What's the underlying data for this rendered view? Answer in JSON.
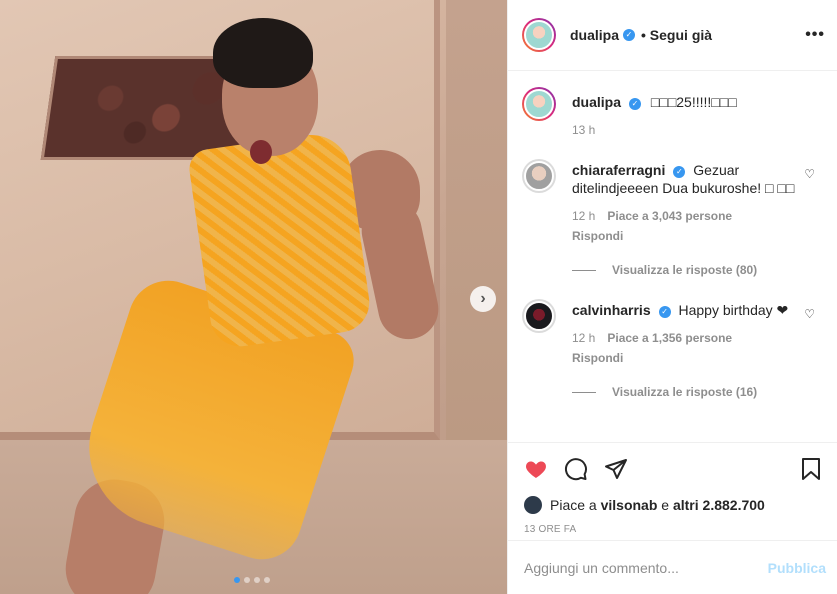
{
  "post": {
    "photo_alt": "",
    "carousel": {
      "total": 4,
      "active_index": 0
    }
  },
  "header": {
    "username": "dualipa",
    "follow_status": "• Segui già",
    "more": "•••"
  },
  "caption": {
    "username": "dualipa",
    "text": "□□□25!!!!!□□□",
    "time": "13 h"
  },
  "comments": [
    {
      "username": "chiaraferragni",
      "text": "Gezuar ditelindjeeeen Dua bukuroshe! □ □□",
      "time": "12 h",
      "likes": "Piace a 3,043 persone",
      "reply": "Rispondi",
      "view_replies": "Visualizza le risposte (80)"
    },
    {
      "username": "calvinharris",
      "text": "Happy birthday ❤",
      "time": "12 h",
      "likes": "Piace a 1,356 persone",
      "reply": "Rispondi",
      "view_replies": "Visualizza le risposte (16)"
    }
  ],
  "likes_line": {
    "prefix": "Piace a",
    "user": "vilsonab",
    "middle": "e",
    "rest": "altri 2.882.700"
  },
  "timestamp": "13 ORE FA",
  "composer": {
    "placeholder": "Aggiungi un commento...",
    "post_label": "Pubblica"
  },
  "colors": {
    "accent": "#3897f0",
    "like": "#ed4956",
    "post_disabled": "#b2dffc"
  }
}
